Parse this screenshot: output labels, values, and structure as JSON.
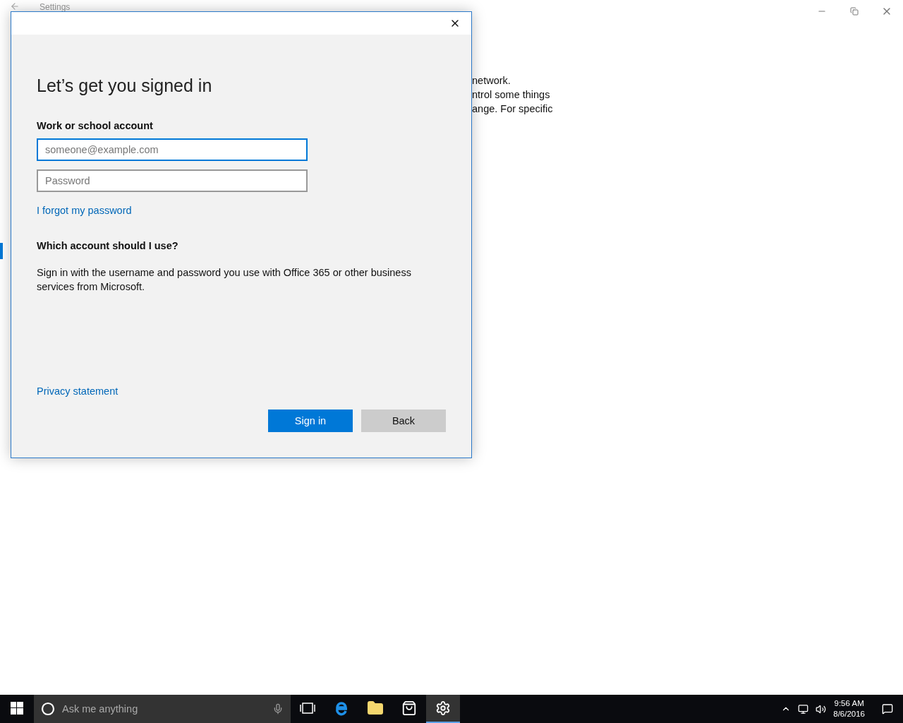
{
  "background_window": {
    "title": "Settings",
    "text_lines": [
      "network.",
      "ntrol some things",
      "ange. For specific"
    ]
  },
  "dialog": {
    "heading": "Let’s get you signed in",
    "account_label": "Work or school account",
    "email": {
      "placeholder": "someone@example.com",
      "focused": true
    },
    "password": {
      "placeholder": "Password",
      "focused": false
    },
    "forgot_link": "I forgot my password",
    "help_heading": "Which account should I use?",
    "help_text": "Sign in with the username and password you use with Office 365 or other business services from Microsoft.",
    "privacy_link": "Privacy statement",
    "buttons": [
      {
        "label": "Sign in",
        "kind": "primary"
      },
      {
        "label": "Back",
        "kind": "secondary"
      }
    ]
  },
  "taskbar": {
    "search": {
      "placeholder": "Ask me anything"
    },
    "apps": [
      {
        "kind": "taskview",
        "selected": false
      },
      {
        "kind": "browser",
        "selected": false
      },
      {
        "kind": "folder",
        "selected": false
      },
      {
        "kind": "store",
        "selected": false
      },
      {
        "kind": "settings",
        "selected": true
      }
    ],
    "clock": {
      "time": "9:56 AM",
      "date": "8/6/2016"
    }
  }
}
